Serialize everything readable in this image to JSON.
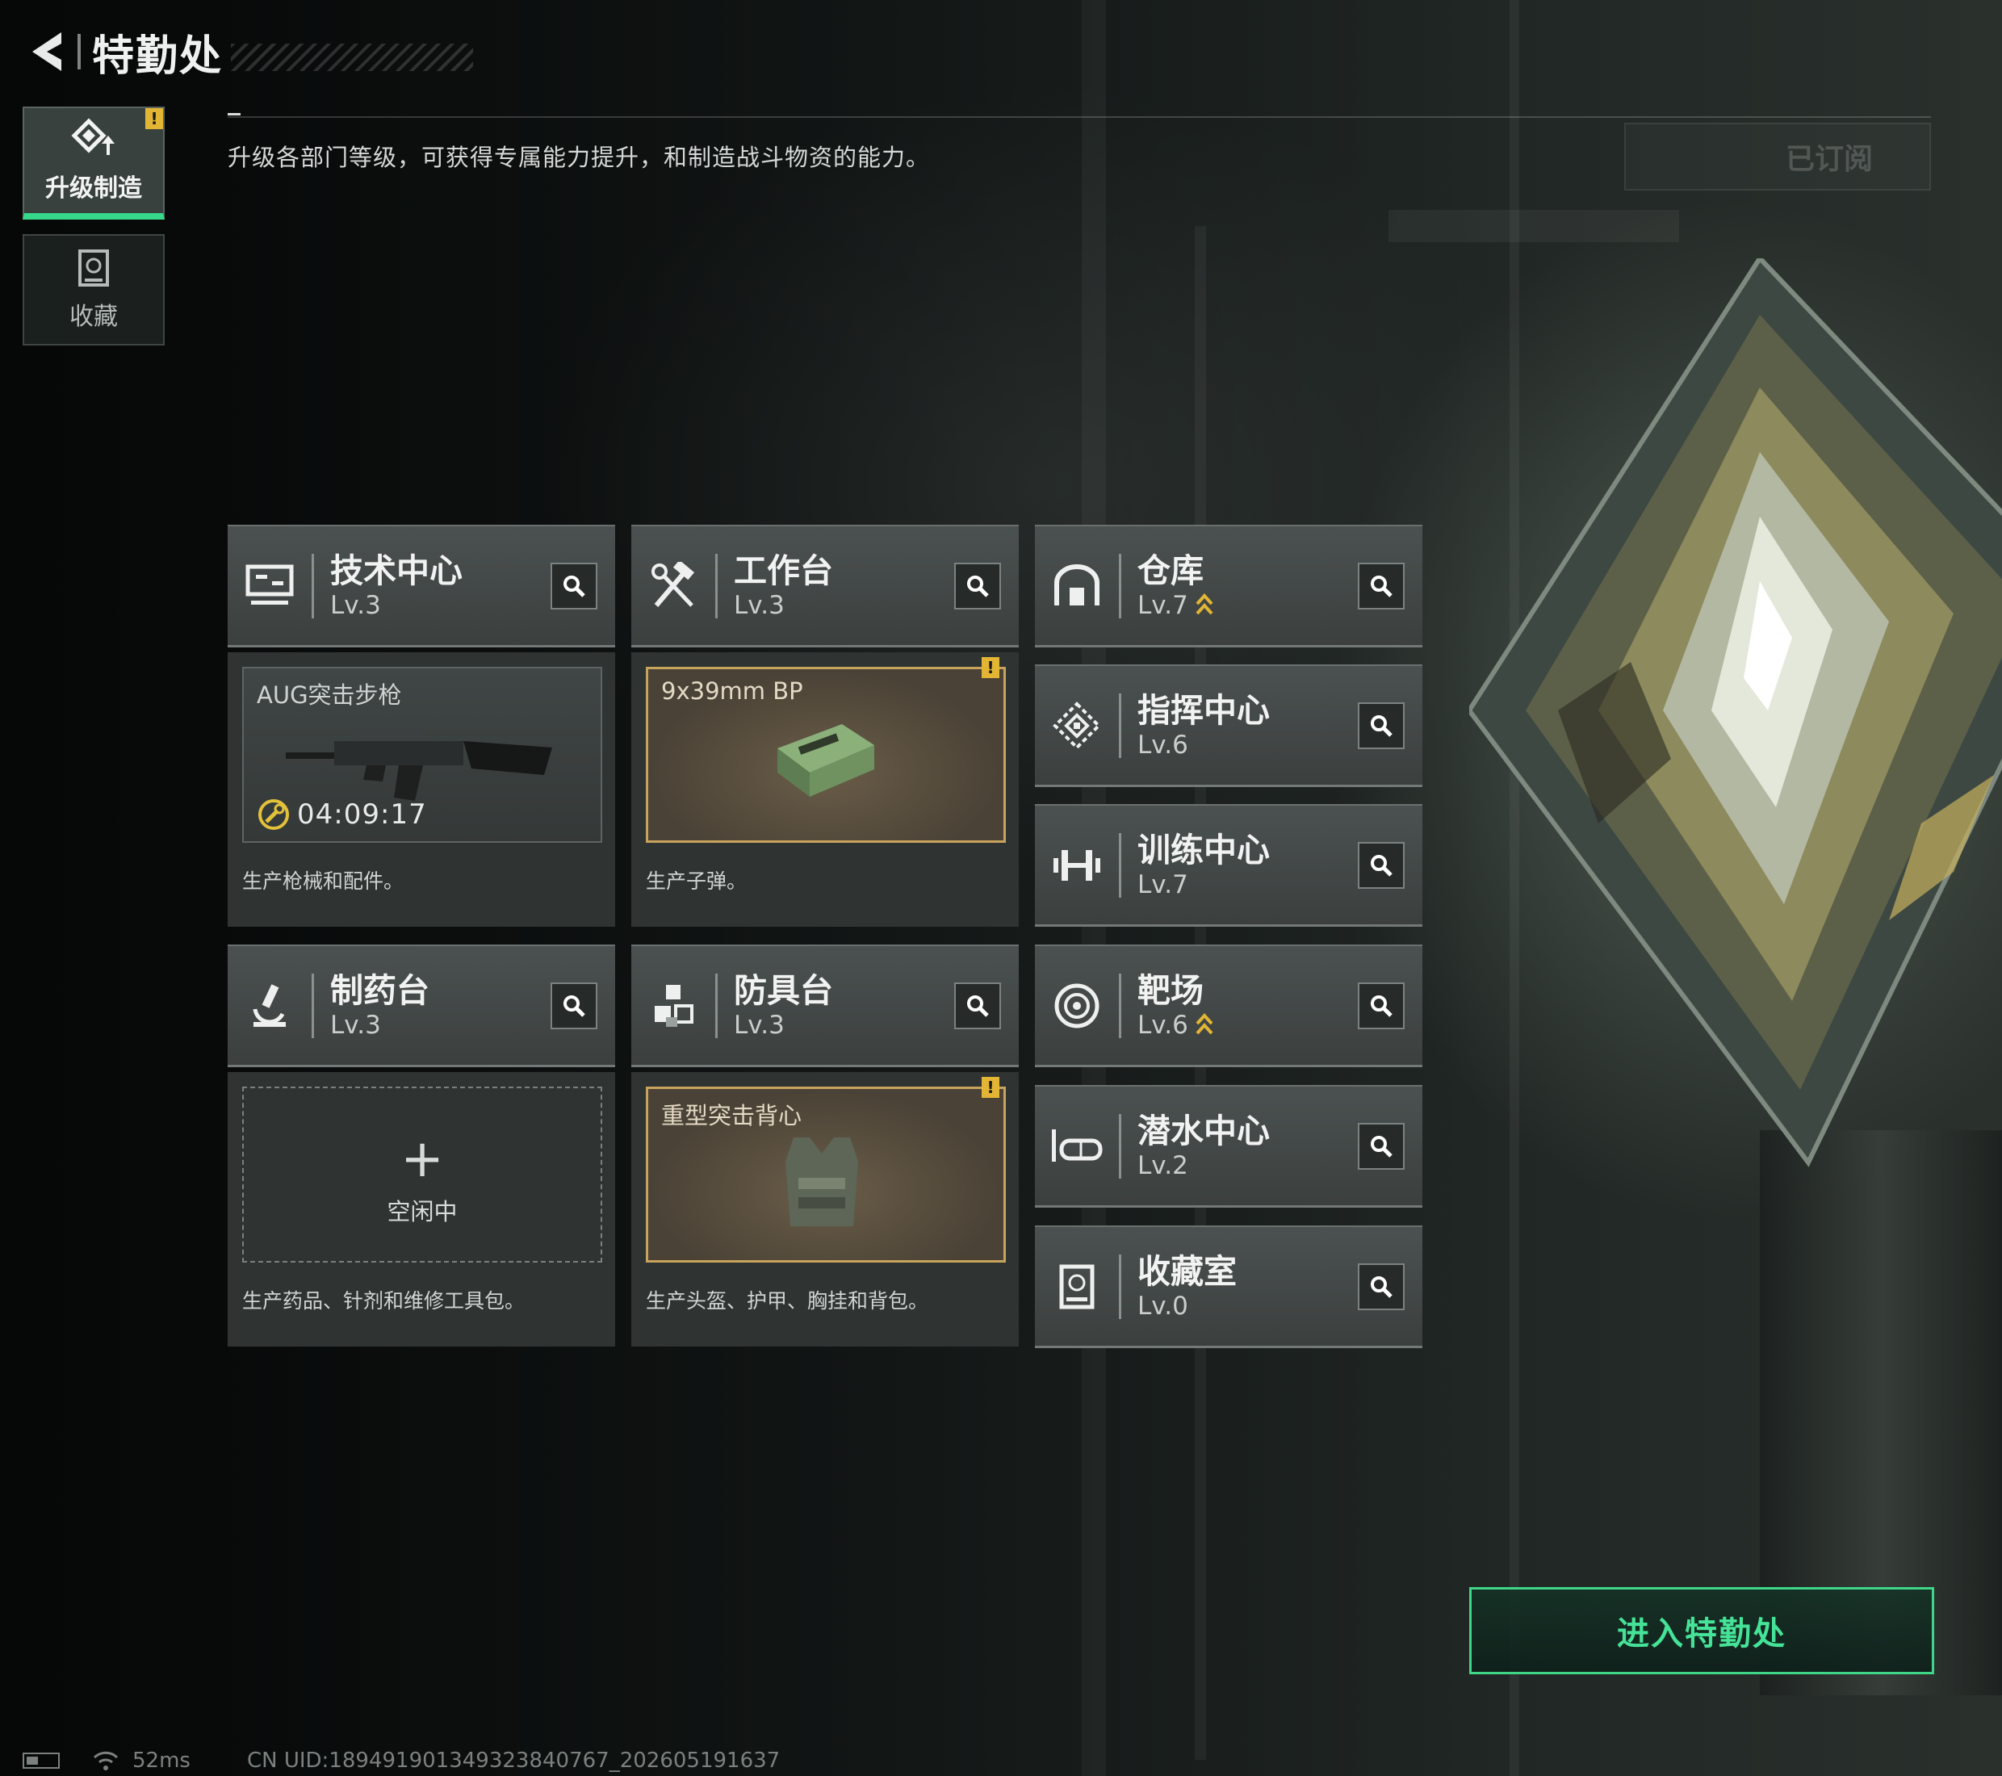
{
  "header": {
    "title": "特勤处"
  },
  "tabs": [
    {
      "label": "升级制造",
      "badge": "!"
    },
    {
      "label": "收藏"
    }
  ],
  "description": "升级各部门等级，可获得专属能力提升，和制造战斗物资的能力。",
  "subscribed_label": "已订阅",
  "facilities": {
    "tech": {
      "name": "技术中心",
      "level": "Lv.3"
    },
    "workbench": {
      "name": "工作台",
      "level": "Lv.3"
    },
    "warehouse": {
      "name": "仓库",
      "level": "Lv.7",
      "upgradable": true
    },
    "command": {
      "name": "指挥中心",
      "level": "Lv.6"
    },
    "training": {
      "name": "训练中心",
      "level": "Lv.7"
    },
    "pharmacy": {
      "name": "制药台",
      "level": "Lv.3"
    },
    "armor": {
      "name": "防具台",
      "level": "Lv.3"
    },
    "range": {
      "name": "靶场",
      "level": "Lv.6",
      "upgradable": true
    },
    "diving": {
      "name": "潜水中心",
      "level": "Lv.2"
    },
    "collection": {
      "name": "收藏室",
      "level": "Lv.0"
    }
  },
  "production": {
    "tech": {
      "item": "AUG突击步枪",
      "timer": "04:09:17",
      "caption": "生产枪械和配件。"
    },
    "workbench": {
      "item": "9x39mm BP",
      "badge": "!",
      "caption": "生产子弹。"
    },
    "pharmacy": {
      "idle_label": "空闲中",
      "plus": "+",
      "caption": "生产药品、针剂和维修工具包。"
    },
    "armor": {
      "item": "重型突击背心",
      "badge": "!",
      "caption": "生产头盔、护甲、胸挂和背包。"
    }
  },
  "enter_button": "进入特勤处",
  "status": {
    "ping": "52ms",
    "uid": "CN UID:18949190134932384076​7_202605191637"
  },
  "colors": {
    "accent": "#3fd688",
    "warning": "#e3b534",
    "gold_border": "#c8a35b"
  }
}
